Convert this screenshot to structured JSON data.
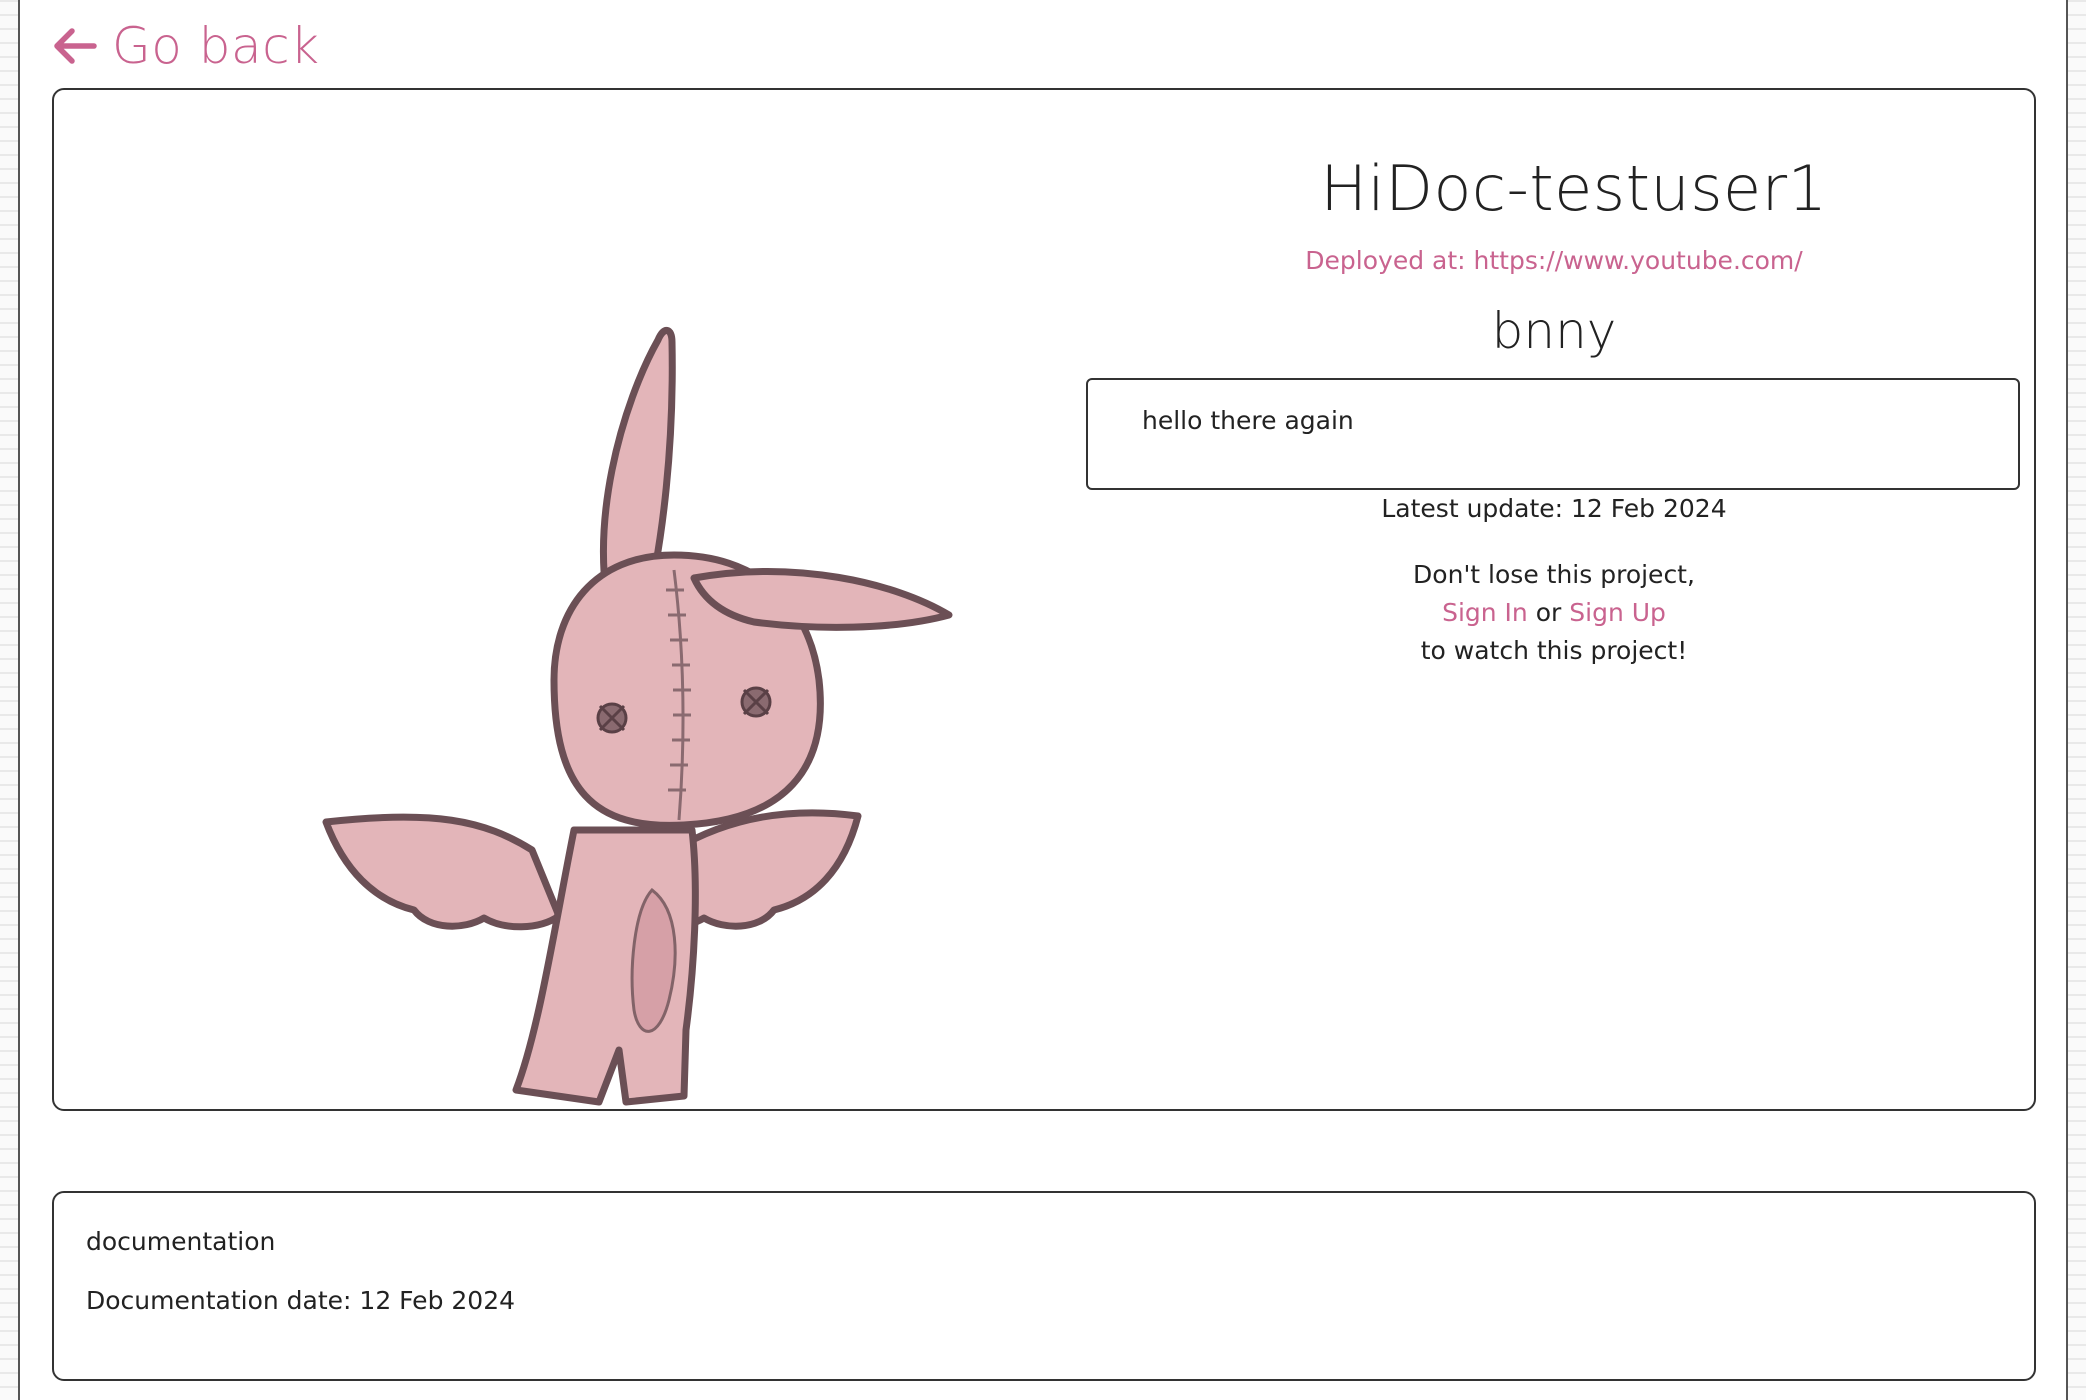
{
  "nav": {
    "back_label": "Go back",
    "back_icon": "arrow-left-icon"
  },
  "project": {
    "title": "HiDoc-testuser1",
    "deployed_label": "Deployed at: https://www.youtube.com/",
    "subtitle": "bnny",
    "description": "hello there again",
    "latest_update": "Latest update: 12 Feb 2024",
    "image_alt": "pink stitched bunny with small wings sketch"
  },
  "signin": {
    "line1": "Don't lose this project,",
    "sign_in": "Sign In",
    "or": "or",
    "sign_up": "Sign Up",
    "line3": "to watch this project!"
  },
  "documentation": {
    "text": "documentation",
    "date": "Documentation date: 12 Feb 2024"
  },
  "colors": {
    "accent": "#c9638f",
    "text": "#222222",
    "border": "#333333",
    "bunny_fill": "#e3b5b9",
    "bunny_outline": "#6b4f55"
  }
}
